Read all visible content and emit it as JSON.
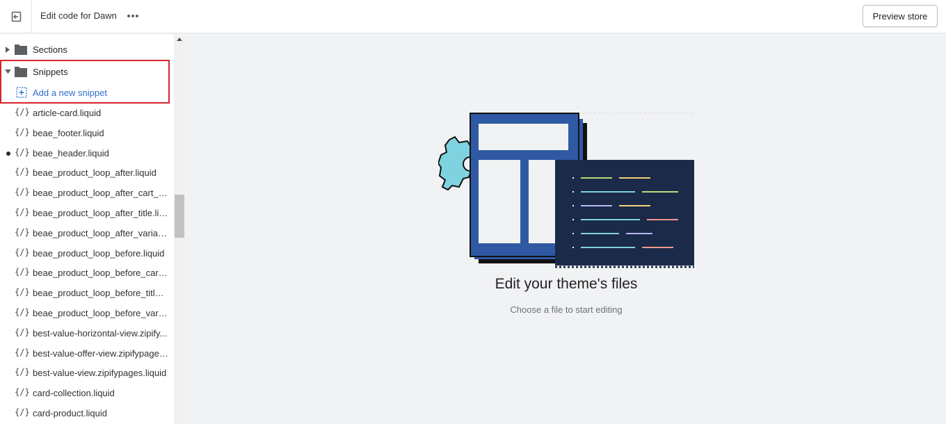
{
  "topbar": {
    "title": "Edit code for Dawn",
    "preview_label": "Preview store"
  },
  "sidebar": {
    "folders": [
      {
        "label": "Sections",
        "expanded": false
      },
      {
        "label": "Snippets",
        "expanded": true
      }
    ],
    "add_snippet_label": "Add a new snippet",
    "file_icon_text": "{/}",
    "files": [
      {
        "name": "article-card.liquid",
        "modified": false
      },
      {
        "name": "beae_footer.liquid",
        "modified": false
      },
      {
        "name": "beae_header.liquid",
        "modified": true
      },
      {
        "name": "beae_product_loop_after.liquid",
        "modified": false
      },
      {
        "name": "beae_product_loop_after_cart_bu...",
        "modified": false
      },
      {
        "name": "beae_product_loop_after_title.liq...",
        "modified": false
      },
      {
        "name": "beae_product_loop_after_variant.l...",
        "modified": false
      },
      {
        "name": "beae_product_loop_before.liquid",
        "modified": false
      },
      {
        "name": "beae_product_loop_before_cart_...",
        "modified": false
      },
      {
        "name": "beae_product_loop_before_title.li...",
        "modified": false
      },
      {
        "name": "beae_product_loop_before_varia...",
        "modified": false
      },
      {
        "name": "best-value-horizontal-view.zipify...",
        "modified": false
      },
      {
        "name": "best-value-offer-view.zipifypages...",
        "modified": false
      },
      {
        "name": "best-value-view.zipifypages.liquid",
        "modified": false
      },
      {
        "name": "card-collection.liquid",
        "modified": false
      },
      {
        "name": "card-product.liquid",
        "modified": false
      }
    ]
  },
  "main": {
    "empty_title": "Edit your theme's files",
    "empty_subtitle": "Choose a file to start editing"
  },
  "colors": {
    "accent_link": "#2c6ecb",
    "highlight_box": "#d9232b",
    "illustration_blue": "#2f5aa3",
    "illustration_dark": "#1b2a48",
    "gear_cyan": "#7fd3e0"
  }
}
